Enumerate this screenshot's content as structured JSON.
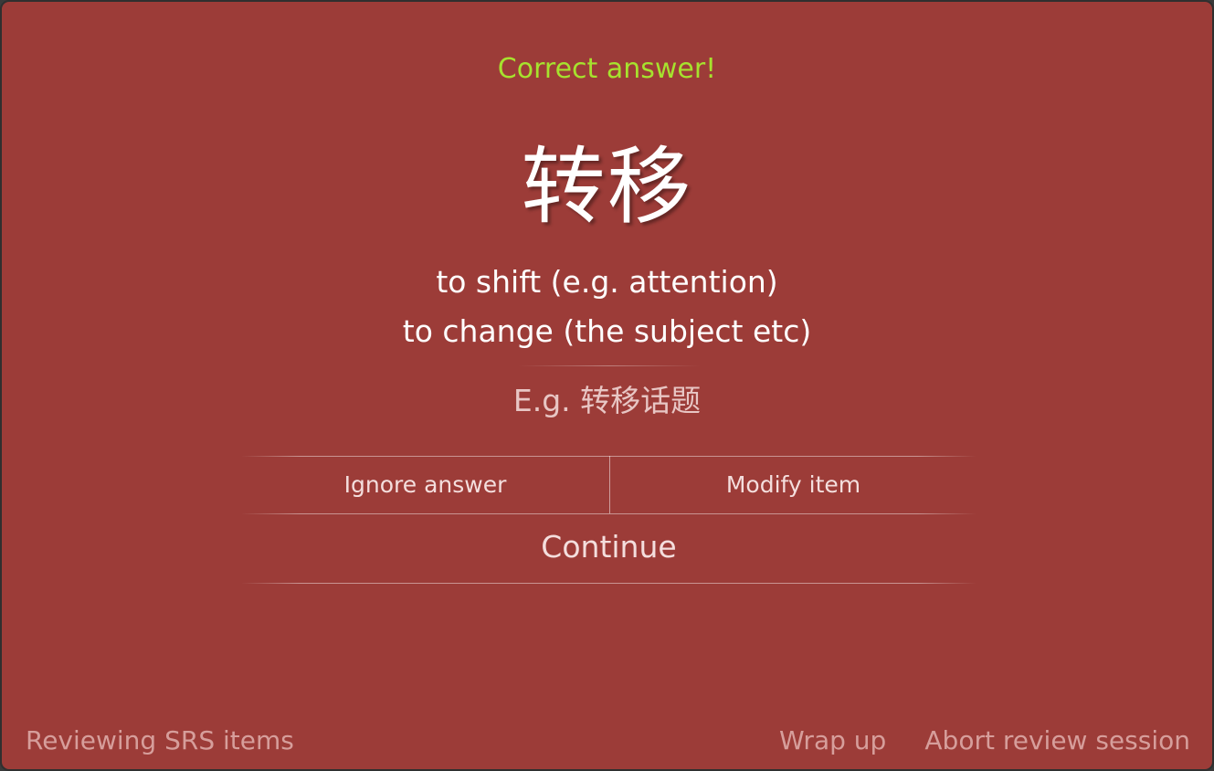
{
  "review": {
    "status": "Correct answer!",
    "status_color": "#a6e22e",
    "background_color": "#9c3c38",
    "hanzi": "转移",
    "meanings": [
      "to shift (e.g. attention)",
      "to change (the subject etc)"
    ],
    "example": "E.g. 转移话题"
  },
  "actions": {
    "ignore_label": "Ignore answer",
    "modify_label": "Modify item",
    "continue_label": "Continue"
  },
  "footer": {
    "mode_label": "Reviewing SRS items",
    "wrap_up_label": "Wrap up",
    "abort_label": "Abort review session"
  }
}
